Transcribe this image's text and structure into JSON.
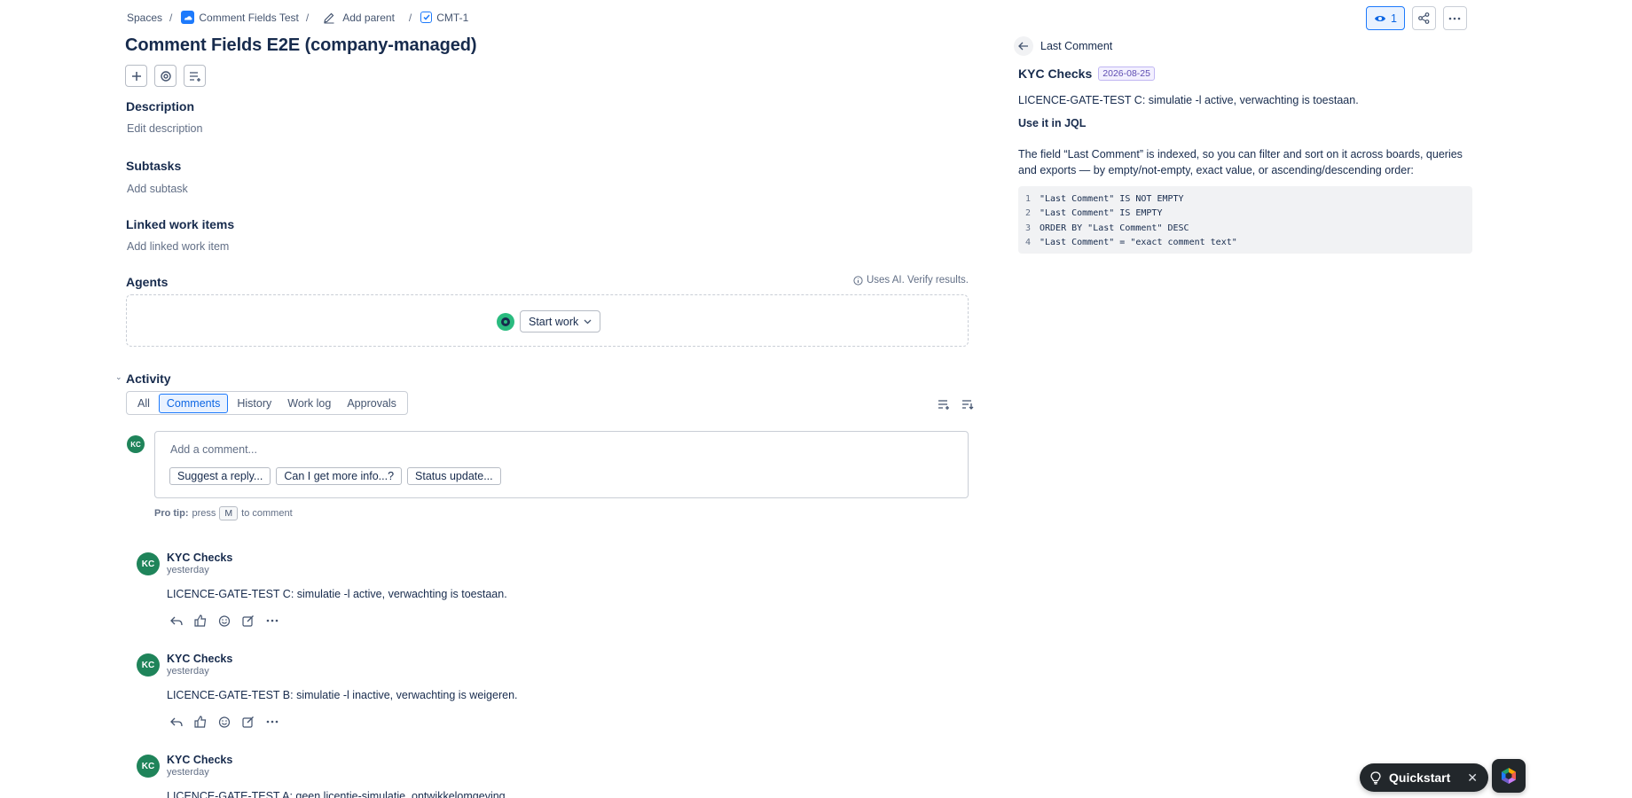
{
  "breadcrumb": {
    "spaces": "Spaces",
    "project": "Comment Fields Test",
    "add_parent": "Add parent",
    "issue_key": "CMT-1"
  },
  "issue": {
    "title": "Comment Fields E2E (company-managed)"
  },
  "description": {
    "heading": "Description",
    "placeholder": "Edit description"
  },
  "subtasks": {
    "heading": "Subtasks",
    "action": "Add subtask"
  },
  "linked": {
    "heading": "Linked work items",
    "action": "Add linked work item"
  },
  "agents": {
    "heading": "Agents",
    "ai_note": "Uses AI. Verify results.",
    "start_label": "Start work"
  },
  "activity": {
    "heading": "Activity",
    "tabs": [
      "All",
      "Comments",
      "History",
      "Work log",
      "Approvals"
    ],
    "active_tab": "Comments"
  },
  "composer": {
    "avatar": "KC",
    "placeholder": "Add a comment...",
    "suggestions": [
      "Suggest a reply...",
      "Can I get more info...?",
      "Status update..."
    ],
    "protip_label": "Pro tip:",
    "protip_press": "press",
    "protip_key": "M",
    "protip_suffix": "to comment"
  },
  "comments": [
    {
      "avatar": "KC",
      "author": "KYC Checks",
      "time": "yesterday",
      "body": "LICENCE-GATE-TEST C: simulatie -l active, verwachting is toestaan."
    },
    {
      "avatar": "KC",
      "author": "KYC Checks",
      "time": "yesterday",
      "body": "LICENCE-GATE-TEST B: simulatie -l inactive, verwachting is weigeren."
    },
    {
      "avatar": "KC",
      "author": "KYC Checks",
      "time": "yesterday",
      "body": "LICENCE-GATE-TEST A: geen licentie-simulatie, ontwikkelomgeving."
    }
  ],
  "watchers": {
    "count": "1"
  },
  "panel": {
    "title": "Last Comment",
    "author": "KYC Checks",
    "date": "2026-08-25",
    "comment": "LICENCE-GATE-TEST C: simulatie -l active, verwachting is toestaan.",
    "jql_heading": "Use it in JQL",
    "jql_desc_1": "The field “Last Comment” is indexed, so you can filter and sort on it across boards, queries",
    "jql_desc_2": "and exports — by empty/not-empty, exact value, or ascending/descending order:",
    "code_lines": [
      {
        "no": "1",
        "text": "\"Last Comment\" IS NOT EMPTY"
      },
      {
        "no": "2",
        "text": "\"Last Comment\" IS EMPTY"
      },
      {
        "no": "3",
        "text": "ORDER BY \"Last Comment\" DESC"
      },
      {
        "no": "4",
        "text": "\"Last Comment\" = \"exact comment text\""
      }
    ]
  },
  "quickstart": {
    "label": "Quickstart"
  },
  "colors": {
    "accent": "#1d7afc",
    "avatar": "#1f845a",
    "agent": "#2abb7f",
    "badge": "#5e4db2"
  }
}
